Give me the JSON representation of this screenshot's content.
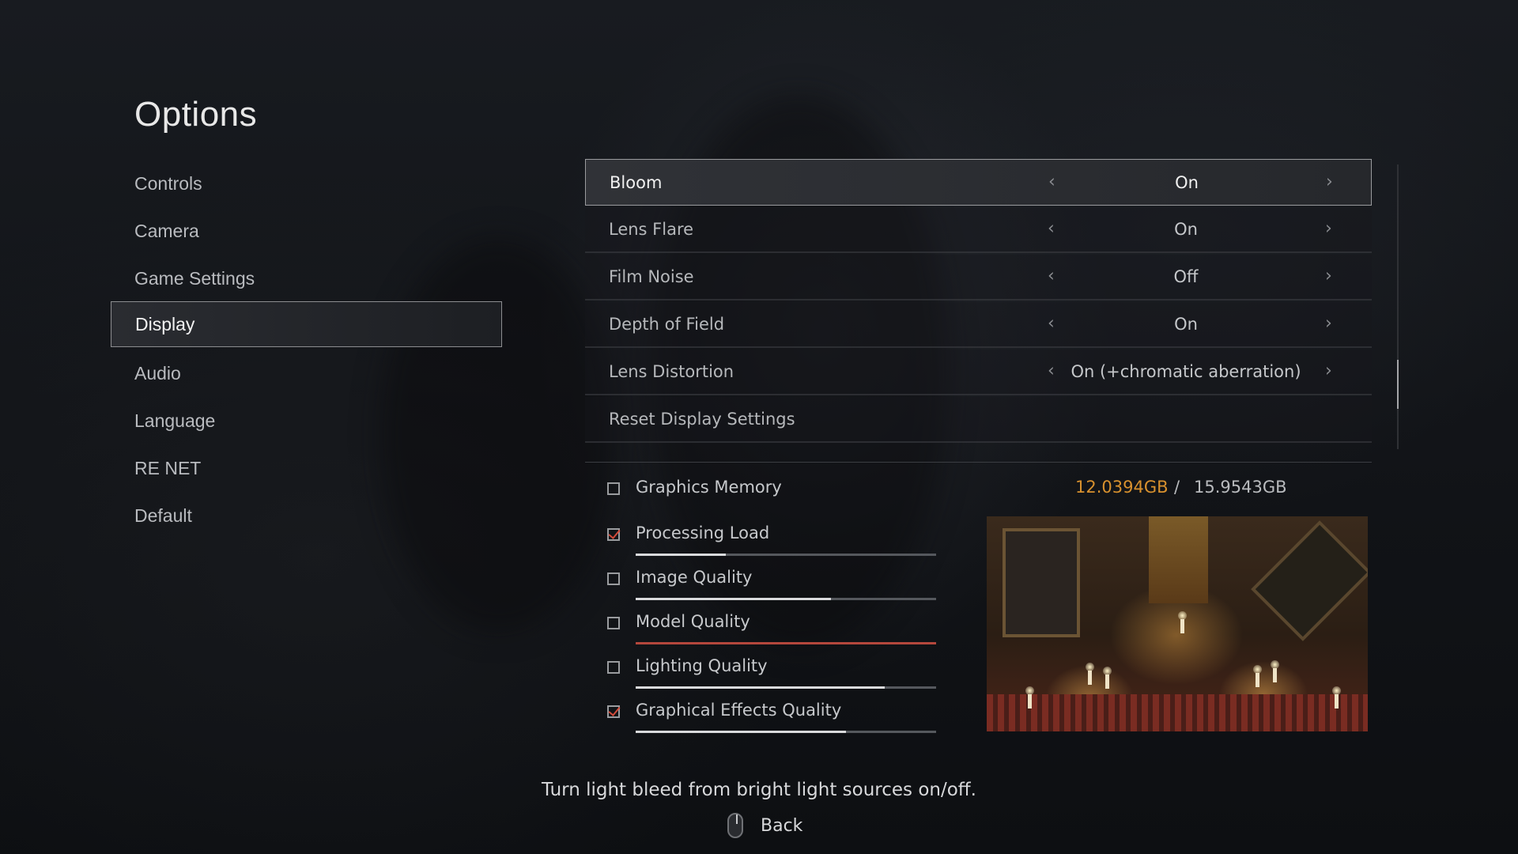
{
  "title": "Options",
  "nav": {
    "items": [
      {
        "label": "Controls"
      },
      {
        "label": "Camera"
      },
      {
        "label": "Game Settings"
      },
      {
        "label": "Display",
        "active": true
      },
      {
        "label": "Audio"
      },
      {
        "label": "Language"
      },
      {
        "label": "RE NET"
      },
      {
        "label": "Default"
      }
    ]
  },
  "settings": [
    {
      "label": "Bloom",
      "value": "On",
      "active": true
    },
    {
      "label": "Lens Flare",
      "value": "On"
    },
    {
      "label": "Film Noise",
      "value": "Off"
    },
    {
      "label": "Depth of Field",
      "value": "On"
    },
    {
      "label": "Lens Distortion",
      "value": "On (+chromatic aberration)"
    },
    {
      "label": "Reset Display Settings",
      "value": ""
    }
  ],
  "arrows": {
    "left": "‹",
    "right": "›"
  },
  "memory": {
    "label": "Graphics Memory",
    "used": "12.0394GB",
    "separator": "/",
    "total": "15.9543GB",
    "checked": false,
    "used_color": "#d8912e"
  },
  "load_items": [
    {
      "label": "Processing Load",
      "checked": true,
      "level": 0.3
    },
    {
      "label": "Image Quality",
      "checked": false,
      "level": 0.65
    },
    {
      "label": "Model Quality",
      "checked": false,
      "level": 1.0,
      "warn": true
    },
    {
      "label": "Lighting Quality",
      "checked": false,
      "level": 0.83
    },
    {
      "label": "Graphical Effects Quality",
      "checked": true,
      "level": 0.7
    }
  ],
  "scroll_position": 0.83,
  "help_text": "Turn light bleed from bright light sources on/off.",
  "back": {
    "label": "Back",
    "icon": "mouse-icon"
  },
  "colors": {
    "accent_check": "#d24a3a",
    "warn_bar": "#b4473c"
  }
}
